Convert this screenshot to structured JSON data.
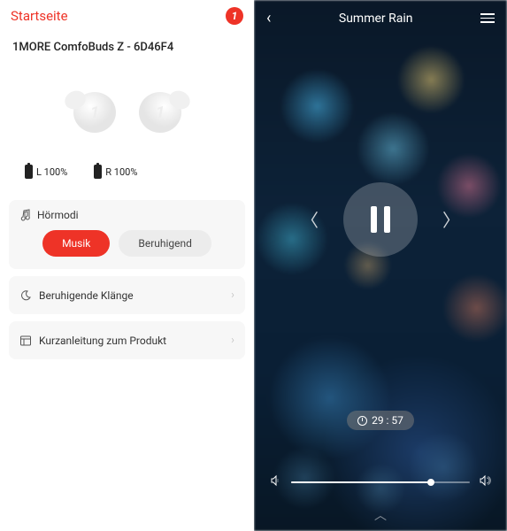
{
  "left": {
    "header_title": "Startseite",
    "header_badge": "1",
    "device_name": "1MORE ComfoBuds Z - 6D46F4",
    "battery": {
      "left_label": "L 100%",
      "right_label": "R 100%"
    },
    "modes": {
      "section_label": "Hörmodi",
      "music": "Musik",
      "calm": "Beruhigend"
    },
    "sounds_row": "Beruhigende Klänge",
    "guide_row": "Kurzanleitung zum Produkt"
  },
  "right": {
    "title": "Summer Rain",
    "timer": "29 : 57",
    "volume_percent": 78
  }
}
